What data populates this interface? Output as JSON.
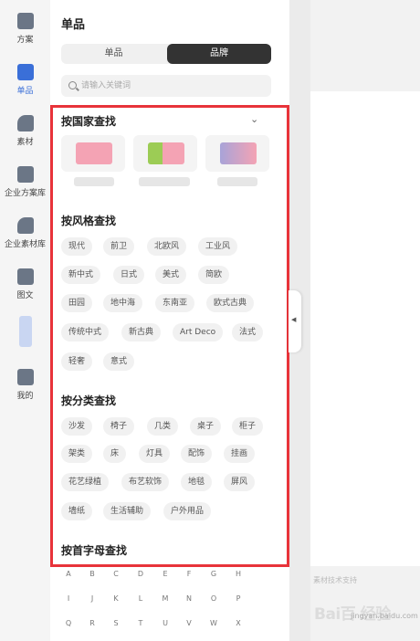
{
  "nav": [
    {
      "label": "方案",
      "icon": "solution-icon",
      "active": false
    },
    {
      "label": "单品",
      "icon": "item-icon",
      "active": true
    },
    {
      "label": "素材",
      "icon": "material-icon",
      "active": false
    },
    {
      "label": "企业方案库",
      "icon": "enterprise-solution-icon",
      "active": false
    },
    {
      "label": "企业素材库",
      "icon": "enterprise-material-icon",
      "active": false
    },
    {
      "label": "图文",
      "icon": "image-text-icon",
      "active": false
    },
    {
      "label": "",
      "icon": "avatar-icon",
      "active": false
    },
    {
      "label": "我的",
      "icon": "mine-icon",
      "active": false
    }
  ],
  "panel": {
    "title": "单品",
    "tabs": [
      {
        "label": "单品"
      },
      {
        "label": "品牌"
      }
    ],
    "active_tab": "品牌",
    "search_placeholder": "请输入关键词"
  },
  "sections": {
    "country": {
      "title": "按国家查找"
    },
    "style": {
      "title": "按风格查找",
      "tags": [
        "现代",
        "前卫",
        "北欧风",
        "工业风",
        "新中式",
        "日式",
        "美式",
        "简欧",
        "田园",
        "地中海",
        "东南亚",
        "欧式古典",
        "传统中式",
        "新古典",
        "Art Deco",
        "法式",
        "轻奢",
        "意式"
      ]
    },
    "category": {
      "title": "按分类查找",
      "tags": [
        "沙发",
        "椅子",
        "几类",
        "桌子",
        "柜子",
        "架类",
        "床",
        "灯具",
        "配饰",
        "挂画",
        "花艺绿植",
        "布艺软饰",
        "地毯",
        "屏风",
        "墙纸",
        "生活辅助",
        "户外用品"
      ]
    },
    "letter": {
      "title": "按首字母查找",
      "letters": [
        "A",
        "B",
        "C",
        "D",
        "E",
        "F",
        "G",
        "H",
        "I",
        "J",
        "K",
        "L",
        "M",
        "N",
        "O",
        "P",
        "Q",
        "R",
        "S",
        "T",
        "U",
        "V",
        "W",
        "X"
      ]
    }
  },
  "canvas": {
    "support": "素材技术支持",
    "watermark": "Bai百 经验",
    "watermark_sub": "jingyan.baidu.com"
  },
  "colors": {
    "highlight": "#e8333a",
    "active_nav": "#3a6fd8",
    "segment_active": "#333333"
  }
}
